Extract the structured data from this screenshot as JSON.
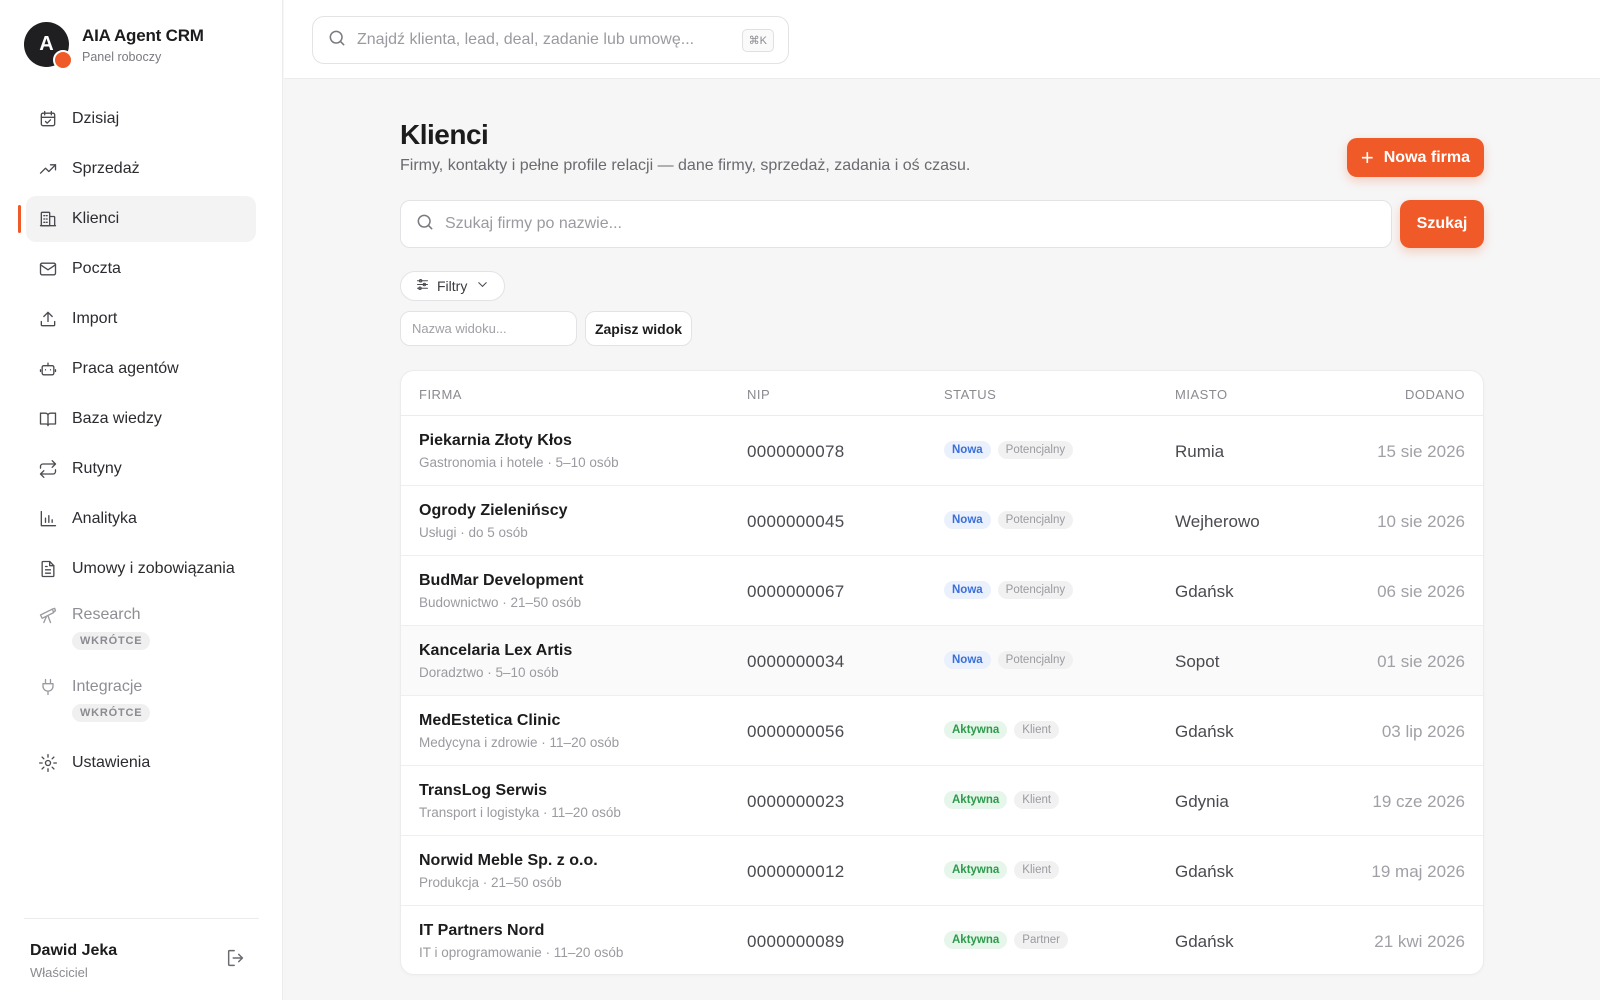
{
  "brand": {
    "logo_letter": "A",
    "name": "AIA Agent CRM",
    "subtitle": "Panel roboczy"
  },
  "sidebar": {
    "items": [
      {
        "label": "Dzisiaj",
        "icon": "calendar-check-icon"
      },
      {
        "label": "Sprzedaż",
        "icon": "trending-up-icon"
      },
      {
        "label": "Klienci",
        "icon": "building-icon",
        "active": true
      },
      {
        "label": "Poczta",
        "icon": "mail-icon"
      },
      {
        "label": "Import",
        "icon": "upload-icon"
      },
      {
        "label": "Praca agentów",
        "icon": "bot-icon"
      },
      {
        "label": "Baza wiedzy",
        "icon": "book-open-icon"
      },
      {
        "label": "Rutyny",
        "icon": "repeat-icon"
      },
      {
        "label": "Analityka",
        "icon": "bar-chart-icon"
      },
      {
        "label": "Umowy i zobowiązania",
        "icon": "file-text-icon"
      },
      {
        "label": "Research",
        "icon": "telescope-icon",
        "badge": "WKRÓTCE"
      },
      {
        "label": "Integracje",
        "icon": "plug-icon",
        "badge": "WKRÓTCE"
      },
      {
        "label": "Ustawienia",
        "icon": "gear-icon"
      }
    ]
  },
  "user": {
    "name": "Dawid Jeka",
    "role": "Właściciel",
    "logout_icon": "logout-icon"
  },
  "topbar": {
    "search_placeholder": "Znajdź klienta, lead, deal, zadanie lub umowę...",
    "shortcut": "⌘K"
  },
  "main": {
    "title": "Klienci",
    "subtitle": "Firmy, kontakty i pełne profile relacji — dane firmy, sprzedaż, zadania i oś czasu.",
    "new_button": "Nowa firma",
    "search_placeholder": "Szukaj firmy po nazwie...",
    "search_button": "Szukaj",
    "filters_label": "Filtry",
    "view_name_placeholder": "Nazwa widoku...",
    "save_view_button": "Zapisz widok"
  },
  "table": {
    "columns": {
      "firma": "FIRMA",
      "nip": "NIP",
      "status": "STATUS",
      "miasto": "MIASTO",
      "dodano": "DODANO"
    },
    "rows": [
      {
        "name": "Piekarnia Złoty Kłos",
        "meta": "Gastronomia i hotele · 5–10 osób",
        "nip": "0000000078",
        "status": "Nowa",
        "type": "Potencjalny",
        "city": "Rumia",
        "date": "15 sie 2026"
      },
      {
        "name": "Ogrody Zielenińscy",
        "meta": "Usługi · do 5 osób",
        "nip": "0000000045",
        "status": "Nowa",
        "type": "Potencjalny",
        "city": "Wejherowo",
        "date": "10 sie 2026"
      },
      {
        "name": "BudMar Development",
        "meta": "Budownictwo · 21–50 osób",
        "nip": "0000000067",
        "status": "Nowa",
        "type": "Potencjalny",
        "city": "Gdańsk",
        "date": "06 sie 2026"
      },
      {
        "name": "Kancelaria Lex Artis",
        "meta": "Doradztwo · 5–10 osób",
        "nip": "0000000034",
        "status": "Nowa",
        "type": "Potencjalny",
        "city": "Sopot",
        "date": "01 sie 2026"
      },
      {
        "name": "MedEstetica Clinic",
        "meta": "Medycyna i zdrowie · 11–20 osób",
        "nip": "0000000056",
        "status": "Aktywna",
        "type": "Klient",
        "city": "Gdańsk",
        "date": "03 lip 2026"
      },
      {
        "name": "TransLog Serwis",
        "meta": "Transport i logistyka · 11–20 osób",
        "nip": "0000000023",
        "status": "Aktywna",
        "type": "Klient",
        "city": "Gdynia",
        "date": "19 cze 2026"
      },
      {
        "name": "Norwid Meble Sp. z o.o.",
        "meta": "Produkcja · 21–50 osób",
        "nip": "0000000012",
        "status": "Aktywna",
        "type": "Klient",
        "city": "Gdańsk",
        "date": "19 maj 2026"
      },
      {
        "name": "IT Partners Nord",
        "meta": "IT i oprogramowanie · 11–20 osób",
        "nip": "0000000089",
        "status": "Aktywna",
        "type": "Partner",
        "city": "Gdańsk",
        "date": "21 kwi 2026"
      }
    ]
  },
  "colors": {
    "accent": "#f05a28",
    "status_new": "#3a6fd8",
    "status_active": "#2d9a4c"
  }
}
